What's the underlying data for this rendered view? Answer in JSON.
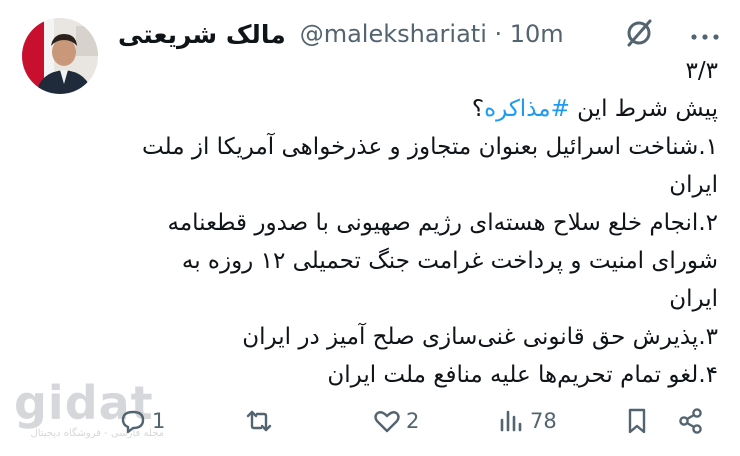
{
  "author": {
    "display_name": "مالک شریعتی",
    "handle": "@malekshariati",
    "separator": " · ",
    "time": "10m"
  },
  "icons": {
    "avatar": "profile-photo",
    "grok": "grok-icon",
    "more": "more-dots-icon",
    "reply": "reply-icon",
    "retweet": "retweet-icon",
    "like": "heart-icon",
    "views": "views-bar-chart-icon",
    "bookmark": "bookmark-icon",
    "share": "share-icon"
  },
  "tweet": {
    "thread_index": "۳/۳",
    "intro_text": "پیش شرط این ",
    "hashtag": "#مذاکره",
    "intro_end": "؟",
    "lines": [
      "۱.شناخت اسرائیل بعنوان متجاوز و عذرخواهی آمریکا از ملت",
      "ایران",
      "۲.انجام خلع سلاح هسته‌ای رژیم صهیونی با صدور قطعنامه",
      "شورای امنیت و پرداخت غرامت جنگ تحمیلی ۱۲ روزه به",
      "ایران",
      "۳.پذیرش حق قانونی غنی‌سازی صلح آمیز در ایران",
      "۴.لغو تمام تحریم‌ها علیه منافع ملت ایران"
    ]
  },
  "metrics": {
    "replies": "1",
    "likes": "2",
    "views": "78"
  },
  "watermark": {
    "logo": "gidat",
    "tagline": "مجله فارسی - فروشگاه دیجیتال"
  },
  "colors": {
    "accent": "#1d9bf0",
    "text": "#0f1419",
    "secondary": "#536471"
  }
}
